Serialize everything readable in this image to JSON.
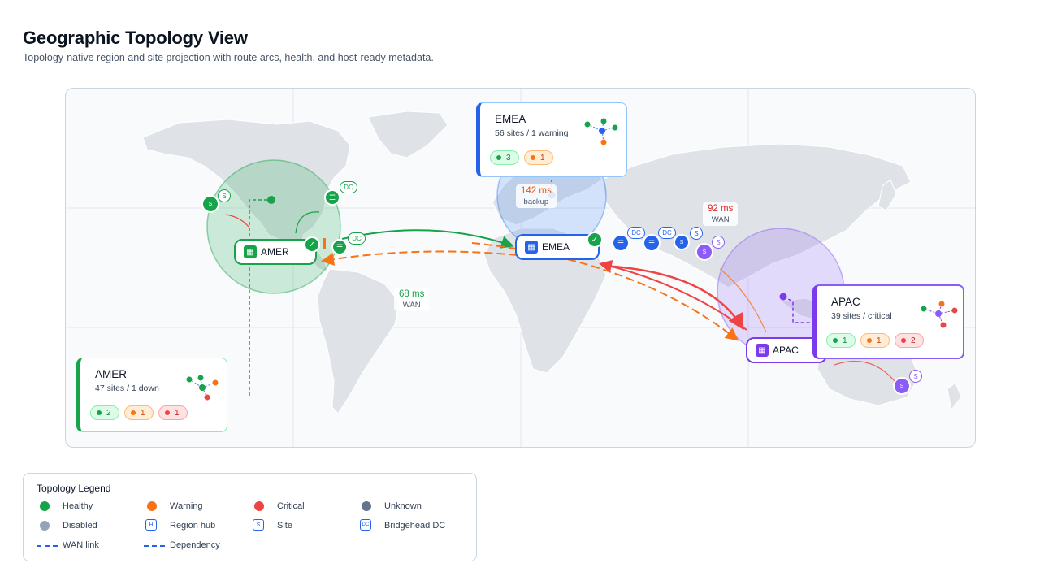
{
  "header": {
    "title": "Geographic Topology View",
    "subtitle": "Topology-native region and site projection with route arcs, health, and host-ready metadata."
  },
  "colors": {
    "healthy": "#16a34a",
    "warning": "#f97316",
    "critical": "#ef4444",
    "unknown": "#64748b",
    "disabled": "#94a3b8",
    "blue": "#2563eb",
    "purple": "#7c3aed"
  },
  "regions": {
    "amer": {
      "hub_label": "AMER",
      "card_title": "AMER",
      "card_subtitle": "47 sites / 1 down",
      "pills": {
        "healthy": "2",
        "warning": "1",
        "critical": "1"
      }
    },
    "emea": {
      "hub_label": "EMEA",
      "card_title": "EMEA",
      "card_subtitle": "56 sites / 1 warning",
      "pills": {
        "healthy": "3",
        "warning": "1"
      }
    },
    "apac": {
      "hub_label": "APAC",
      "card_title": "APAC",
      "card_subtitle": "39 sites / critical",
      "pills": {
        "healthy": "1",
        "warning": "1",
        "critical": "2"
      }
    }
  },
  "badges": {
    "site": "S",
    "dc": "DC"
  },
  "links": {
    "amer_emea": {
      "latency": "68 ms",
      "type": "WAN"
    },
    "emea_apac": {
      "latency": "92 ms",
      "type": "WAN"
    },
    "emea_backup": {
      "latency": "142 ms",
      "type": "backup"
    }
  },
  "legend": {
    "title": "Topology Legend",
    "items": {
      "healthy": "Healthy",
      "warning": "Warning",
      "critical": "Critical",
      "unknown": "Unknown",
      "disabled": "Disabled",
      "region_hub": "Region hub",
      "site": "Site",
      "bridgehead_dc": "Bridgehead DC",
      "wan_link": "WAN link",
      "dependency": "Dependency"
    },
    "symbols": {
      "hub": "H",
      "site": "S",
      "dc": "DC"
    }
  }
}
